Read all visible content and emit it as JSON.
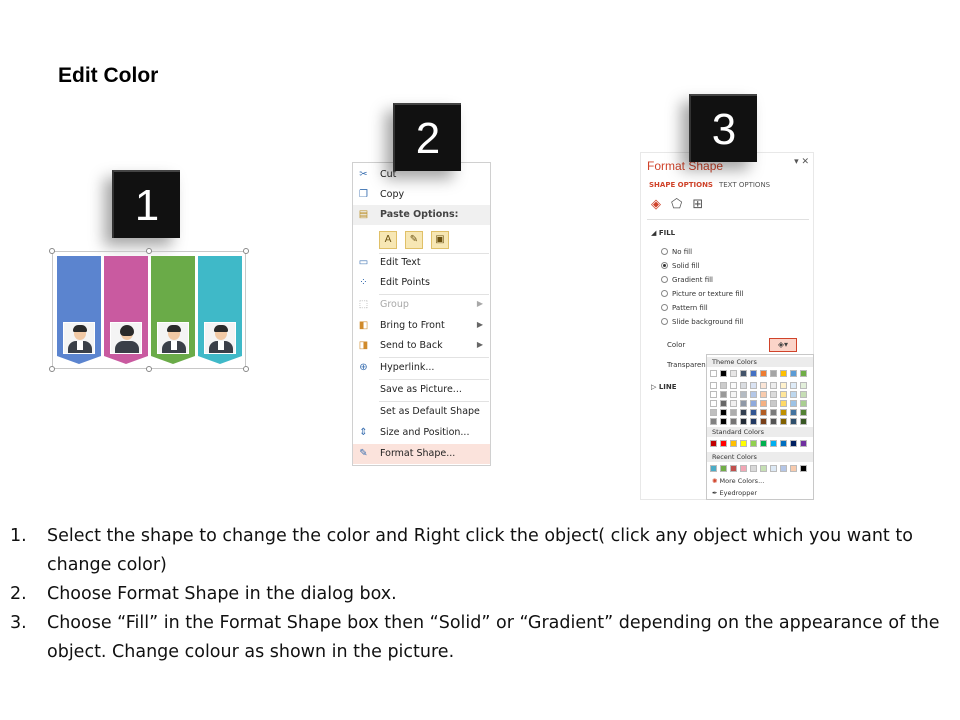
{
  "title": "Edit Color",
  "badges": [
    "1",
    "2",
    "3"
  ],
  "banners": {
    "colors": [
      "#5b84cf",
      "#c95aa0",
      "#6aab48",
      "#3fb9c8"
    ]
  },
  "context_menu": {
    "items": [
      {
        "label": "Cut",
        "icon": "scissors-icon"
      },
      {
        "label": "Copy",
        "icon": "copy-icon"
      },
      {
        "label": "Paste Options:",
        "icon": "paste-icon"
      },
      {
        "label": "Edit Text",
        "icon": "edit-text-icon"
      },
      {
        "label": "Edit Points",
        "icon": "edit-points-icon"
      },
      {
        "label": "Group",
        "icon": "group-icon"
      },
      {
        "label": "Bring to Front",
        "icon": "bring-front-icon"
      },
      {
        "label": "Send to Back",
        "icon": "send-back-icon"
      },
      {
        "label": "Hyperlink...",
        "icon": "hyperlink-icon"
      },
      {
        "label": "Save as Picture...",
        "icon": ""
      },
      {
        "label": "Set as Default Shape",
        "icon": ""
      },
      {
        "label": "Size and Position...",
        "icon": "size-position-icon"
      },
      {
        "label": "Format Shape...",
        "icon": "format-shape-icon"
      }
    ]
  },
  "format_pane": {
    "title": "Format Shape",
    "tab_active": "SHAPE OPTIONS",
    "tab_inactive": "TEXT OPTIONS",
    "fill_section": "FILL",
    "fill_options": [
      "No fill",
      "Solid fill",
      "Gradient fill",
      "Picture or texture fill",
      "Pattern fill",
      "Slide background fill"
    ],
    "color_label": "Color",
    "transparency_label": "Transparency",
    "line_section": "LINE",
    "palette": {
      "theme_heading": "Theme Colors",
      "standard_heading": "Standard Colors",
      "recent_heading": "Recent Colors",
      "more_colors": "More Colors...",
      "eyedropper": "Eyedropper",
      "theme_top": [
        "#ffffff",
        "#000000",
        "#e7e6e6",
        "#44546a",
        "#4472c4",
        "#ed7d31",
        "#a5a5a5",
        "#ffc000",
        "#5b9bd5",
        "#70ad47"
      ],
      "standard": [
        "#c00000",
        "#ff0000",
        "#ffc000",
        "#ffff00",
        "#92d050",
        "#00b050",
        "#00b0f0",
        "#0070c0",
        "#002060",
        "#7030a0"
      ],
      "recent": [
        "#4bacc6",
        "#70ad47",
        "#c0504d",
        "#f2a7b5",
        "#d9d9d9",
        "#c6e0b4",
        "#dde9f5",
        "#b4c6e7",
        "#f8cbad",
        "#000000"
      ]
    }
  },
  "instructions": [
    {
      "num": "1.",
      "text": "Select the shape to change the color and Right click the object( click any object which you want to change color)"
    },
    {
      "num": "2.",
      "text": "Choose Format Shape in the dialog box."
    },
    {
      "num": "3.",
      "text": "Choose “Fill” in the Format Shape box then “Solid” or “Gradient” depending on the appearance of the object. Change colour as shown in the picture."
    }
  ]
}
